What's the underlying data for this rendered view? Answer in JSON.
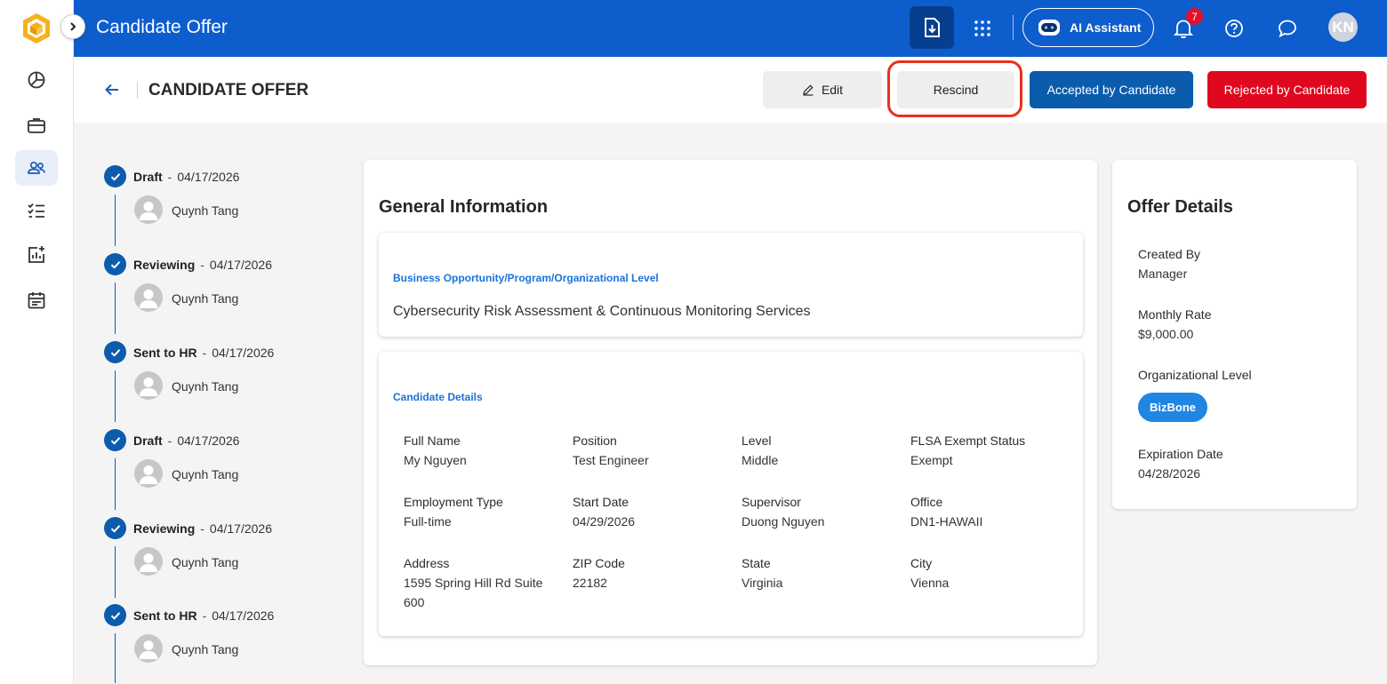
{
  "topbar": {
    "title": "Candidate Offer",
    "ai_label": "AI Assistant",
    "notification_count": "7",
    "user_initials": "KN"
  },
  "header": {
    "title": "CANDIDATE OFFER",
    "edit_label": "Edit",
    "rescind_label": "Rescind",
    "accept_label": "Accepted by Candidate",
    "reject_label": "Rejected by Candidate"
  },
  "timeline": [
    {
      "status": "Draft",
      "date": "04/17/2026",
      "person": "Quynh Tang"
    },
    {
      "status": "Reviewing",
      "date": "04/17/2026",
      "person": "Quynh Tang"
    },
    {
      "status": "Sent to HR",
      "date": "04/17/2026",
      "person": "Quynh Tang"
    },
    {
      "status": "Draft",
      "date": "04/17/2026",
      "person": "Quynh Tang"
    },
    {
      "status": "Reviewing",
      "date": "04/17/2026",
      "person": "Quynh Tang"
    },
    {
      "status": "Sent to HR",
      "date": "04/17/2026",
      "person": "Quynh Tang"
    }
  ],
  "general": {
    "title": "General Information",
    "opportunity_label": "Business Opportunity/Program/Organizational Level",
    "opportunity_value": "Cybersecurity Risk Assessment & Continuous Monitoring Services",
    "candidate_label": "Candidate Details",
    "fields": [
      {
        "label": "Full Name",
        "value": "My Nguyen"
      },
      {
        "label": "Position",
        "value": "Test Engineer"
      },
      {
        "label": "Level",
        "value": "Middle"
      },
      {
        "label": "FLSA Exempt Status",
        "value": "Exempt"
      },
      {
        "label": "Employment Type",
        "value": "Full-time"
      },
      {
        "label": "Start Date",
        "value": "04/29/2026"
      },
      {
        "label": "Supervisor",
        "value": "Duong Nguyen"
      },
      {
        "label": "Office",
        "value": "DN1-HAWAII"
      },
      {
        "label": "Address",
        "value": "1595 Spring Hill Rd Suite 600"
      },
      {
        "label": "ZIP Code",
        "value": "22182"
      },
      {
        "label": "State",
        "value": "Virginia"
      },
      {
        "label": "City",
        "value": "Vienna"
      }
    ]
  },
  "offer": {
    "title": "Offer Details",
    "created_by_label": "Created By",
    "created_by_value": "Manager",
    "monthly_rate_label": "Monthly Rate",
    "monthly_rate_value": "$9,000.00",
    "org_level_label": "Organizational Level",
    "org_level_value": "BizBone",
    "expiration_label": "Expiration Date",
    "expiration_value": "04/28/2026"
  },
  "colors": {
    "brand_blue": "#0e5dcc",
    "accept_blue": "#0b5cad",
    "reject_red": "#e0081e",
    "highlight_ring": "#e8301c"
  }
}
